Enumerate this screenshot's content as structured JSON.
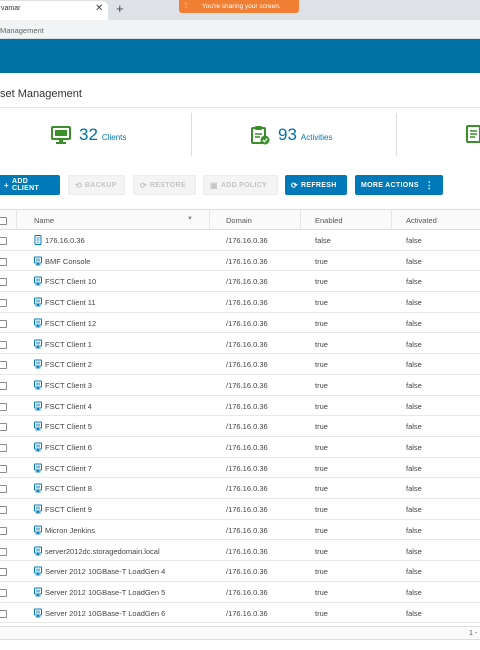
{
  "browser": {
    "tab_title": "vamar",
    "tab_close": "✕",
    "new_tab": "+",
    "share_banner": "You're sharing your screen.",
    "address": "Management"
  },
  "page": {
    "title": "set Management"
  },
  "summary": {
    "clients": {
      "value": "32",
      "label": "Clients"
    },
    "activities": {
      "value": "93",
      "label": "Activities"
    }
  },
  "toolbar": {
    "add_client": "ADD CLIENT",
    "backup": "BACKUP",
    "restore": "RESTORE",
    "add_policy": "ADD POLICY",
    "refresh": "REFRESH",
    "more_actions": "MORE ACTIONS"
  },
  "table": {
    "headers": {
      "name": "Name",
      "domain": "Domain",
      "enabled": "Enabled",
      "activated": "Activated"
    },
    "rows": [
      {
        "name": "176.16.0.36",
        "domain": "/176.16.0.36",
        "enabled": "false",
        "activated": "false",
        "icon": "server-icon"
      },
      {
        "name": "BMF Console",
        "domain": "/176.16.0.36",
        "enabled": "true",
        "activated": "false",
        "icon": "client-icon"
      },
      {
        "name": "FSCT Client 10",
        "domain": "/176.16.0.36",
        "enabled": "true",
        "activated": "false",
        "icon": "client-icon"
      },
      {
        "name": "FSCT Client 11",
        "domain": "/176.16.0.36",
        "enabled": "true",
        "activated": "false",
        "icon": "client-icon"
      },
      {
        "name": "FSCT Client 12",
        "domain": "/176.16.0.36",
        "enabled": "true",
        "activated": "false",
        "icon": "client-icon"
      },
      {
        "name": "FSCT Client 1",
        "domain": "/176.16.0.36",
        "enabled": "true",
        "activated": "false",
        "icon": "client-icon"
      },
      {
        "name": "FSCT Client 2",
        "domain": "/176.16.0.36",
        "enabled": "true",
        "activated": "false",
        "icon": "client-icon"
      },
      {
        "name": "FSCT Client 3",
        "domain": "/176.16.0.36",
        "enabled": "true",
        "activated": "false",
        "icon": "client-icon"
      },
      {
        "name": "FSCT Client 4",
        "domain": "/176.16.0.36",
        "enabled": "true",
        "activated": "false",
        "icon": "client-icon"
      },
      {
        "name": "FSCT Client 5",
        "domain": "/176.16.0.36",
        "enabled": "true",
        "activated": "false",
        "icon": "client-icon"
      },
      {
        "name": "FSCT Client 6",
        "domain": "/176.16.0.36",
        "enabled": "true",
        "activated": "false",
        "icon": "client-icon"
      },
      {
        "name": "FSCT Client 7",
        "domain": "/176.16.0.36",
        "enabled": "true",
        "activated": "false",
        "icon": "client-icon"
      },
      {
        "name": "FSCT Client 8",
        "domain": "/176.16.0.36",
        "enabled": "true",
        "activated": "false",
        "icon": "client-icon"
      },
      {
        "name": "FSCT Client 9",
        "domain": "/176.16.0.36",
        "enabled": "true",
        "activated": "false",
        "icon": "client-icon"
      },
      {
        "name": "Micron Jenkins",
        "domain": "/176.16.0.36",
        "enabled": "true",
        "activated": "false",
        "icon": "client-icon"
      },
      {
        "name": "server2012dc.storagedomain.local",
        "domain": "/176.16.0.36",
        "enabled": "true",
        "activated": "false",
        "icon": "client-icon"
      },
      {
        "name": "Server 2012 10GBase-T LoadGen 4",
        "domain": "/176.16.0.36",
        "enabled": "true",
        "activated": "false",
        "icon": "client-icon"
      },
      {
        "name": "Server 2012 10GBase-T LoadGen 5",
        "domain": "/176.16.0.36",
        "enabled": "true",
        "activated": "false",
        "icon": "client-icon"
      },
      {
        "name": "Server 2012 10GBase-T LoadGen 6",
        "domain": "/176.16.0.36",
        "enabled": "true",
        "activated": "false",
        "icon": "client-icon"
      }
    ]
  },
  "footer": {
    "pagination": "1 -"
  },
  "colors": {
    "header": "#0072a3",
    "primary_button": "#0079b8",
    "icon_green": "#3a8f2a",
    "share_banner": "#f07e33"
  }
}
